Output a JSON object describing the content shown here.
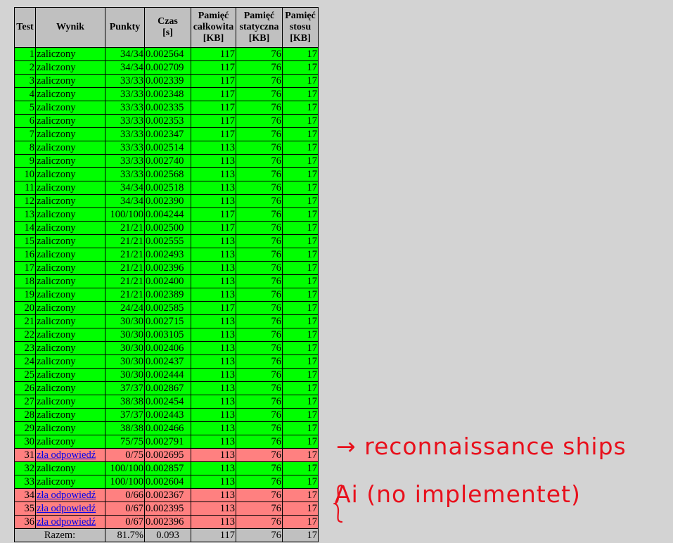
{
  "headers": {
    "test": "Test",
    "result": "Wynik",
    "points": "Punkty",
    "time_1": "Czas",
    "time_2": "[s]",
    "mem_total_1": "Pamięć",
    "mem_total_2": "całkowita",
    "mem_total_3": "[KB]",
    "mem_static_1": "Pamięć",
    "mem_static_2": "statyczna",
    "mem_static_3": "[KB]",
    "mem_stack_1": "Pamięć",
    "mem_stack_2": "stosu",
    "mem_stack_3": "[KB]"
  },
  "rows": [
    {
      "test": "1",
      "result": "zaliczony",
      "status": "pass",
      "points": "34/34",
      "time": "0.002564",
      "total": "117",
      "static": "76",
      "stack": "17"
    },
    {
      "test": "2",
      "result": "zaliczony",
      "status": "pass",
      "points": "34/34",
      "time": "0.002709",
      "total": "117",
      "static": "76",
      "stack": "17"
    },
    {
      "test": "3",
      "result": "zaliczony",
      "status": "pass",
      "points": "33/33",
      "time": "0.002339",
      "total": "117",
      "static": "76",
      "stack": "17"
    },
    {
      "test": "4",
      "result": "zaliczony",
      "status": "pass",
      "points": "33/33",
      "time": "0.002348",
      "total": "117",
      "static": "76",
      "stack": "17"
    },
    {
      "test": "5",
      "result": "zaliczony",
      "status": "pass",
      "points": "33/33",
      "time": "0.002335",
      "total": "117",
      "static": "76",
      "stack": "17"
    },
    {
      "test": "6",
      "result": "zaliczony",
      "status": "pass",
      "points": "33/33",
      "time": "0.002353",
      "total": "117",
      "static": "76",
      "stack": "17"
    },
    {
      "test": "7",
      "result": "zaliczony",
      "status": "pass",
      "points": "33/33",
      "time": "0.002347",
      "total": "117",
      "static": "76",
      "stack": "17"
    },
    {
      "test": "8",
      "result": "zaliczony",
      "status": "pass",
      "points": "33/33",
      "time": "0.002514",
      "total": "113",
      "static": "76",
      "stack": "17"
    },
    {
      "test": "9",
      "result": "zaliczony",
      "status": "pass",
      "points": "33/33",
      "time": "0.002740",
      "total": "113",
      "static": "76",
      "stack": "17"
    },
    {
      "test": "10",
      "result": "zaliczony",
      "status": "pass",
      "points": "33/33",
      "time": "0.002568",
      "total": "113",
      "static": "76",
      "stack": "17"
    },
    {
      "test": "11",
      "result": "zaliczony",
      "status": "pass",
      "points": "34/34",
      "time": "0.002518",
      "total": "113",
      "static": "76",
      "stack": "17"
    },
    {
      "test": "12",
      "result": "zaliczony",
      "status": "pass",
      "points": "34/34",
      "time": "0.002390",
      "total": "113",
      "static": "76",
      "stack": "17"
    },
    {
      "test": "13",
      "result": "zaliczony",
      "status": "pass",
      "points": "100/100",
      "time": "0.004244",
      "total": "117",
      "static": "76",
      "stack": "17"
    },
    {
      "test": "14",
      "result": "zaliczony",
      "status": "pass",
      "points": "21/21",
      "time": "0.002500",
      "total": "117",
      "static": "76",
      "stack": "17"
    },
    {
      "test": "15",
      "result": "zaliczony",
      "status": "pass",
      "points": "21/21",
      "time": "0.002555",
      "total": "113",
      "static": "76",
      "stack": "17"
    },
    {
      "test": "16",
      "result": "zaliczony",
      "status": "pass",
      "points": "21/21",
      "time": "0.002493",
      "total": "113",
      "static": "76",
      "stack": "17"
    },
    {
      "test": "17",
      "result": "zaliczony",
      "status": "pass",
      "points": "21/21",
      "time": "0.002396",
      "total": "113",
      "static": "76",
      "stack": "17"
    },
    {
      "test": "18",
      "result": "zaliczony",
      "status": "pass",
      "points": "21/21",
      "time": "0.002400",
      "total": "113",
      "static": "76",
      "stack": "17"
    },
    {
      "test": "19",
      "result": "zaliczony",
      "status": "pass",
      "points": "21/21",
      "time": "0.002389",
      "total": "113",
      "static": "76",
      "stack": "17"
    },
    {
      "test": "20",
      "result": "zaliczony",
      "status": "pass",
      "points": "24/24",
      "time": "0.002585",
      "total": "117",
      "static": "76",
      "stack": "17"
    },
    {
      "test": "21",
      "result": "zaliczony",
      "status": "pass",
      "points": "30/30",
      "time": "0.002715",
      "total": "113",
      "static": "76",
      "stack": "17"
    },
    {
      "test": "22",
      "result": "zaliczony",
      "status": "pass",
      "points": "30/30",
      "time": "0.003105",
      "total": "113",
      "static": "76",
      "stack": "17"
    },
    {
      "test": "23",
      "result": "zaliczony",
      "status": "pass",
      "points": "30/30",
      "time": "0.002406",
      "total": "113",
      "static": "76",
      "stack": "17"
    },
    {
      "test": "24",
      "result": "zaliczony",
      "status": "pass",
      "points": "30/30",
      "time": "0.002437",
      "total": "113",
      "static": "76",
      "stack": "17"
    },
    {
      "test": "25",
      "result": "zaliczony",
      "status": "pass",
      "points": "30/30",
      "time": "0.002444",
      "total": "113",
      "static": "76",
      "stack": "17"
    },
    {
      "test": "26",
      "result": "zaliczony",
      "status": "pass",
      "points": "37/37",
      "time": "0.002867",
      "total": "113",
      "static": "76",
      "stack": "17"
    },
    {
      "test": "27",
      "result": "zaliczony",
      "status": "pass",
      "points": "38/38",
      "time": "0.002454",
      "total": "113",
      "static": "76",
      "stack": "17"
    },
    {
      "test": "28",
      "result": "zaliczony",
      "status": "pass",
      "points": "37/37",
      "time": "0.002443",
      "total": "113",
      "static": "76",
      "stack": "17"
    },
    {
      "test": "29",
      "result": "zaliczony",
      "status": "pass",
      "points": "38/38",
      "time": "0.002466",
      "total": "113",
      "static": "76",
      "stack": "17"
    },
    {
      "test": "30",
      "result": "zaliczony",
      "status": "pass",
      "points": "75/75",
      "time": "0.002791",
      "total": "113",
      "static": "76",
      "stack": "17"
    },
    {
      "test": "31",
      "result": "zła odpowiedź",
      "status": "fail",
      "points": "0/75",
      "time": "0.002695",
      "total": "113",
      "static": "76",
      "stack": "17"
    },
    {
      "test": "32",
      "result": "zaliczony",
      "status": "pass",
      "points": "100/100",
      "time": "0.002857",
      "total": "113",
      "static": "76",
      "stack": "17"
    },
    {
      "test": "33",
      "result": "zaliczony",
      "status": "pass",
      "points": "100/100",
      "time": "0.002604",
      "total": "113",
      "static": "76",
      "stack": "17"
    },
    {
      "test": "34",
      "result": "zła odpowiedź",
      "status": "fail",
      "points": "0/66",
      "time": "0.002367",
      "total": "113",
      "static": "76",
      "stack": "17"
    },
    {
      "test": "35",
      "result": "zła odpowiedź",
      "status": "fail",
      "points": "0/67",
      "time": "0.002395",
      "total": "113",
      "static": "76",
      "stack": "17"
    },
    {
      "test": "36",
      "result": "zła odpowiedź",
      "status": "fail",
      "points": "0/67",
      "time": "0.002396",
      "total": "113",
      "static": "76",
      "stack": "17"
    }
  ],
  "summary": {
    "label": "Razem:",
    "points": "81.7%",
    "time": "0.093",
    "total": "117",
    "static": "76",
    "stack": "17"
  },
  "annotations": {
    "note1": "→ reconnaissance ships",
    "note2": "Ai (no implementet)"
  },
  "colors": {
    "pass": "#00ff00",
    "fail": "#ff8080",
    "header": "#c0c0c0",
    "link": "#0000ee",
    "annotation": "#e8101c"
  }
}
